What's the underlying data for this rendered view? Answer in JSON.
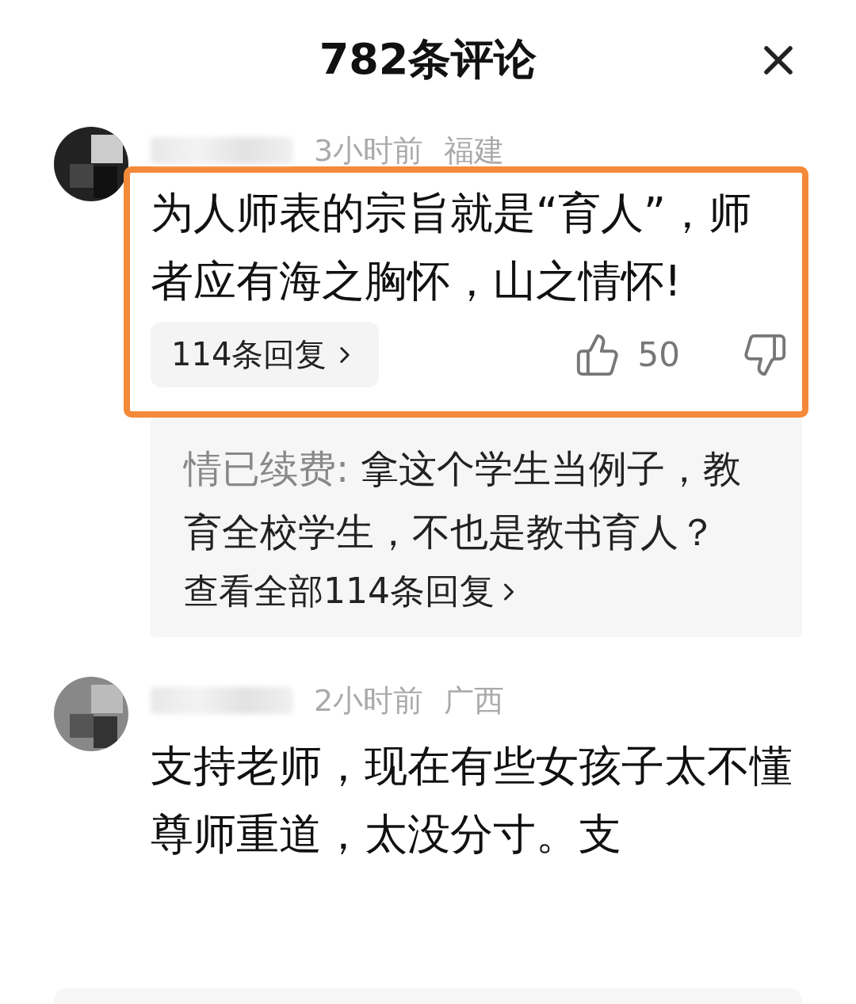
{
  "header": {
    "title": "782条评论"
  },
  "comments": [
    {
      "time": "3小时前",
      "region": "福建",
      "text": "为人师表的宗旨就是“育人”，师者应有海之胸怀，山之情怀!",
      "highlighted": true,
      "replies_button": "114条回复",
      "likes": "50",
      "reply_preview": {
        "author": "情已续费:",
        "text": "拿这个学生当例子，教育全校学生，不也是教书育人？",
        "view_all": "查看全部114条回复"
      }
    },
    {
      "time": "2小时前",
      "region": "广西",
      "text": "支持老师，现在有些女孩子太不懂尊师重道，太没分寸。支",
      "highlighted": false
    }
  ]
}
